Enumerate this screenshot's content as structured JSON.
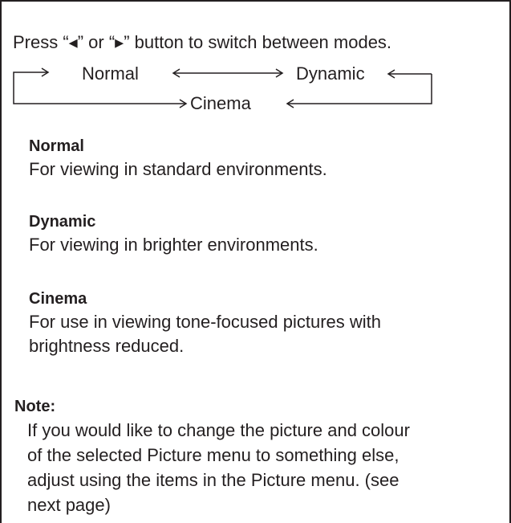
{
  "intro": "Press “◂” or “▸” button to switch between modes.",
  "diagram": {
    "modes": [
      "Normal",
      "Dynamic",
      "Cinema"
    ]
  },
  "sections": [
    {
      "title": "Normal",
      "lines": [
        "For viewing in standard environments."
      ]
    },
    {
      "title": "Dynamic",
      "lines": [
        "For viewing in brighter environments."
      ]
    },
    {
      "title": "Cinema",
      "lines": [
        "For use in viewing tone-focused pictures with",
        "brightness reduced."
      ]
    }
  ],
  "note": {
    "title": "Note:",
    "lines": [
      "If you would like to change the picture and colour",
      "of the selected Picture menu to something else,",
      "adjust using the items in the Picture menu. (see",
      "next page)"
    ]
  }
}
